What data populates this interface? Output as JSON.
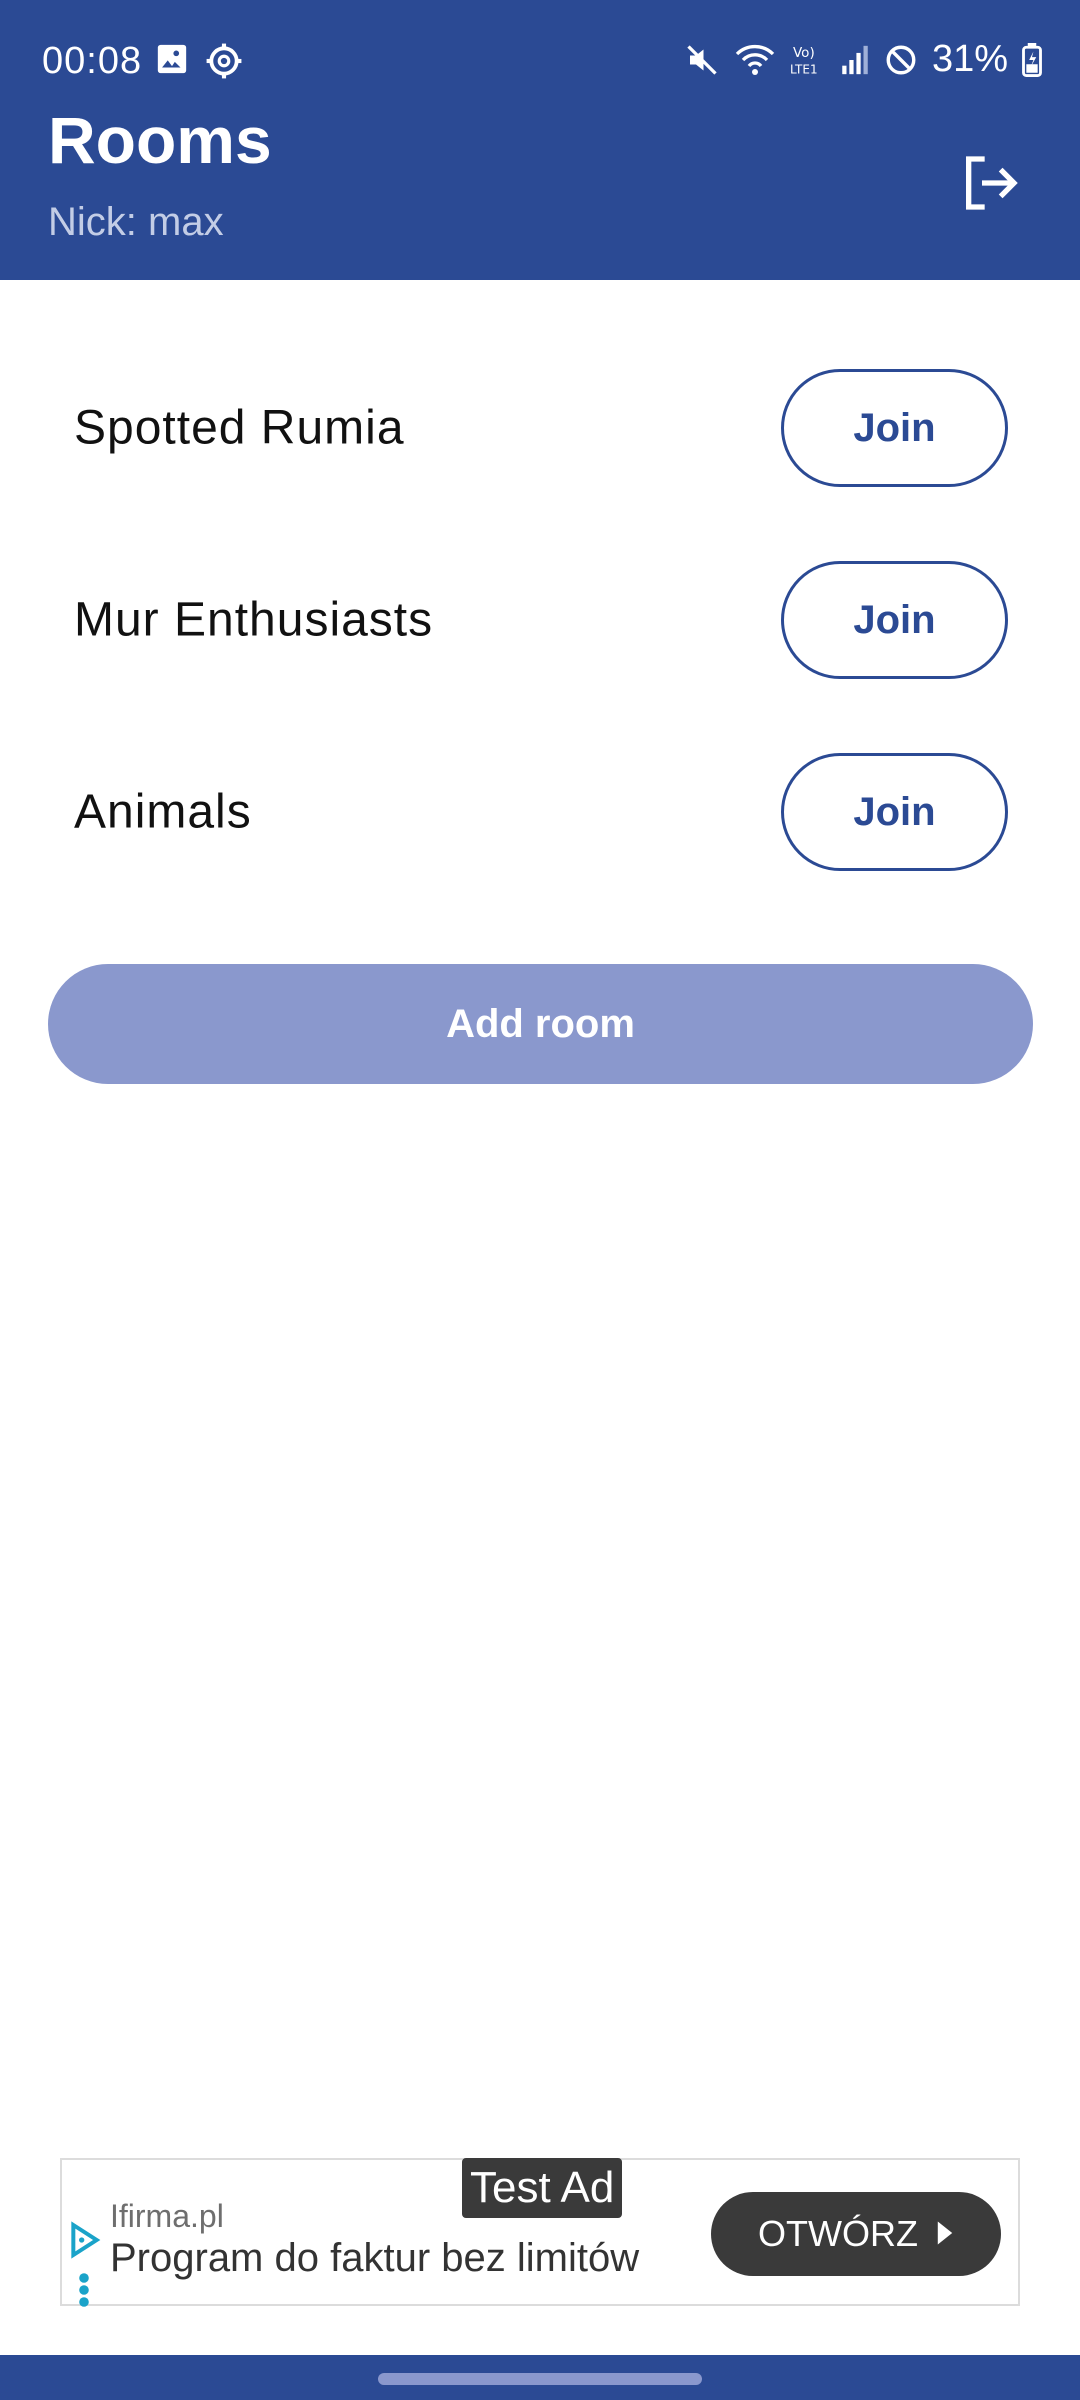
{
  "status_bar": {
    "time": "00:08",
    "battery": "31%",
    "icons": [
      "image-icon",
      "settings-icon",
      "mute-icon",
      "wifi-icon",
      "volte-icon",
      "signal-icon",
      "dnd-icon",
      "battery-icon"
    ]
  },
  "app_bar": {
    "title": "Rooms",
    "subtitle": "Nick: max",
    "logout_icon": "logout-icon"
  },
  "rooms": [
    {
      "name": "Spotted Rumia",
      "join_label": "Join"
    },
    {
      "name": "Mur Enthusiasts",
      "join_label": "Join"
    },
    {
      "name": "Animals",
      "join_label": "Join"
    }
  ],
  "add_room_label": "Add room",
  "ad": {
    "badge": "Test Ad",
    "advertiser": "Ifirma.pl",
    "headline": "Program do faktur bez limitów",
    "cta": "OTWÓRZ"
  },
  "colors": {
    "primary": "#2b4a94",
    "primary_light": "#8a98cd",
    "text": "#111111",
    "background": "#ffffff"
  }
}
